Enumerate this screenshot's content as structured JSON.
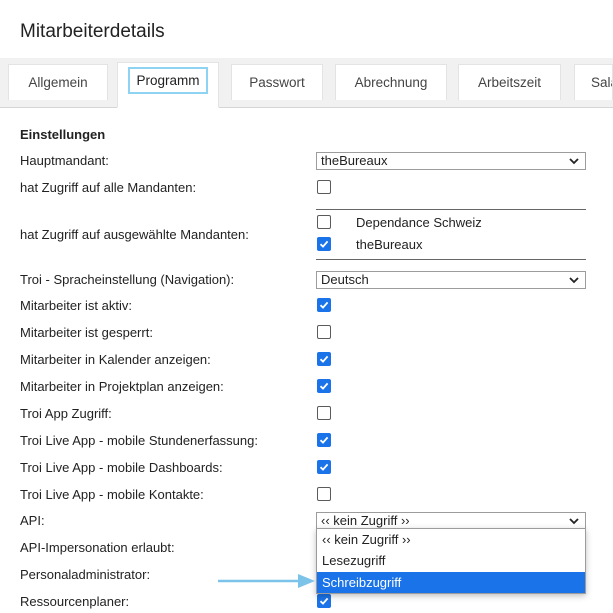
{
  "page": {
    "title": "Mitarbeiterdetails"
  },
  "tabs": [
    {
      "label": "Allgemein",
      "active": false
    },
    {
      "label": "Programm",
      "active": true
    },
    {
      "label": "Passwort",
      "active": false
    },
    {
      "label": "Abrechnung",
      "active": false
    },
    {
      "label": "Arbeitszeit",
      "active": false
    },
    {
      "label": "Salä",
      "active": false
    }
  ],
  "section": {
    "title": "Einstellungen"
  },
  "rows": {
    "hauptmandant": {
      "label": "Hauptmandant:",
      "value": "theBureaux"
    },
    "alle_mandanten": {
      "label": "hat Zugriff auf alle Mandanten:",
      "checked": false
    },
    "ausgewaehlte_mandanten": {
      "label": "hat Zugriff auf ausgewählte Mandanten:",
      "options": [
        {
          "label": "Dependance Schweiz",
          "checked": false
        },
        {
          "label": "theBureaux",
          "checked": true
        }
      ]
    },
    "sprache": {
      "label": "Troi - Spracheinstellung (Navigation):",
      "value": "Deutsch"
    },
    "aktiv": {
      "label": "Mitarbeiter ist aktiv:",
      "checked": true
    },
    "gesperrt": {
      "label": "Mitarbeiter ist gesperrt:",
      "checked": false
    },
    "kalender": {
      "label": "Mitarbeiter in Kalender anzeigen:",
      "checked": true
    },
    "projektplan": {
      "label": "Mitarbeiter in Projektplan anzeigen:",
      "checked": true
    },
    "app_zugriff": {
      "label": "Troi App Zugriff:",
      "checked": false
    },
    "live_stunden": {
      "label": "Troi Live App - mobile Stundenerfassung:",
      "checked": true
    },
    "live_dashboards": {
      "label": "Troi Live App - mobile Dashboards:",
      "checked": true
    },
    "live_kontakte": {
      "label": "Troi Live App - mobile Kontakte:",
      "checked": false
    },
    "api": {
      "label": "API:",
      "value": "‹‹ kein Zugriff ››",
      "options": [
        "‹‹ kein Zugriff ››",
        "Lesezugriff",
        "Schreibzugriff"
      ],
      "highlighted": "Schreibzugriff"
    },
    "api_impersonation": {
      "label": "API-Impersonation erlaubt:"
    },
    "personaladmin": {
      "label": "Personaladministrator:"
    },
    "ressourcenplaner": {
      "label": "Ressourcenplaner:",
      "checked": true
    }
  },
  "colors": {
    "accent": "#1a73e8",
    "tab_highlight": "#8fd3f2",
    "arrow": "#7cc3ea"
  }
}
